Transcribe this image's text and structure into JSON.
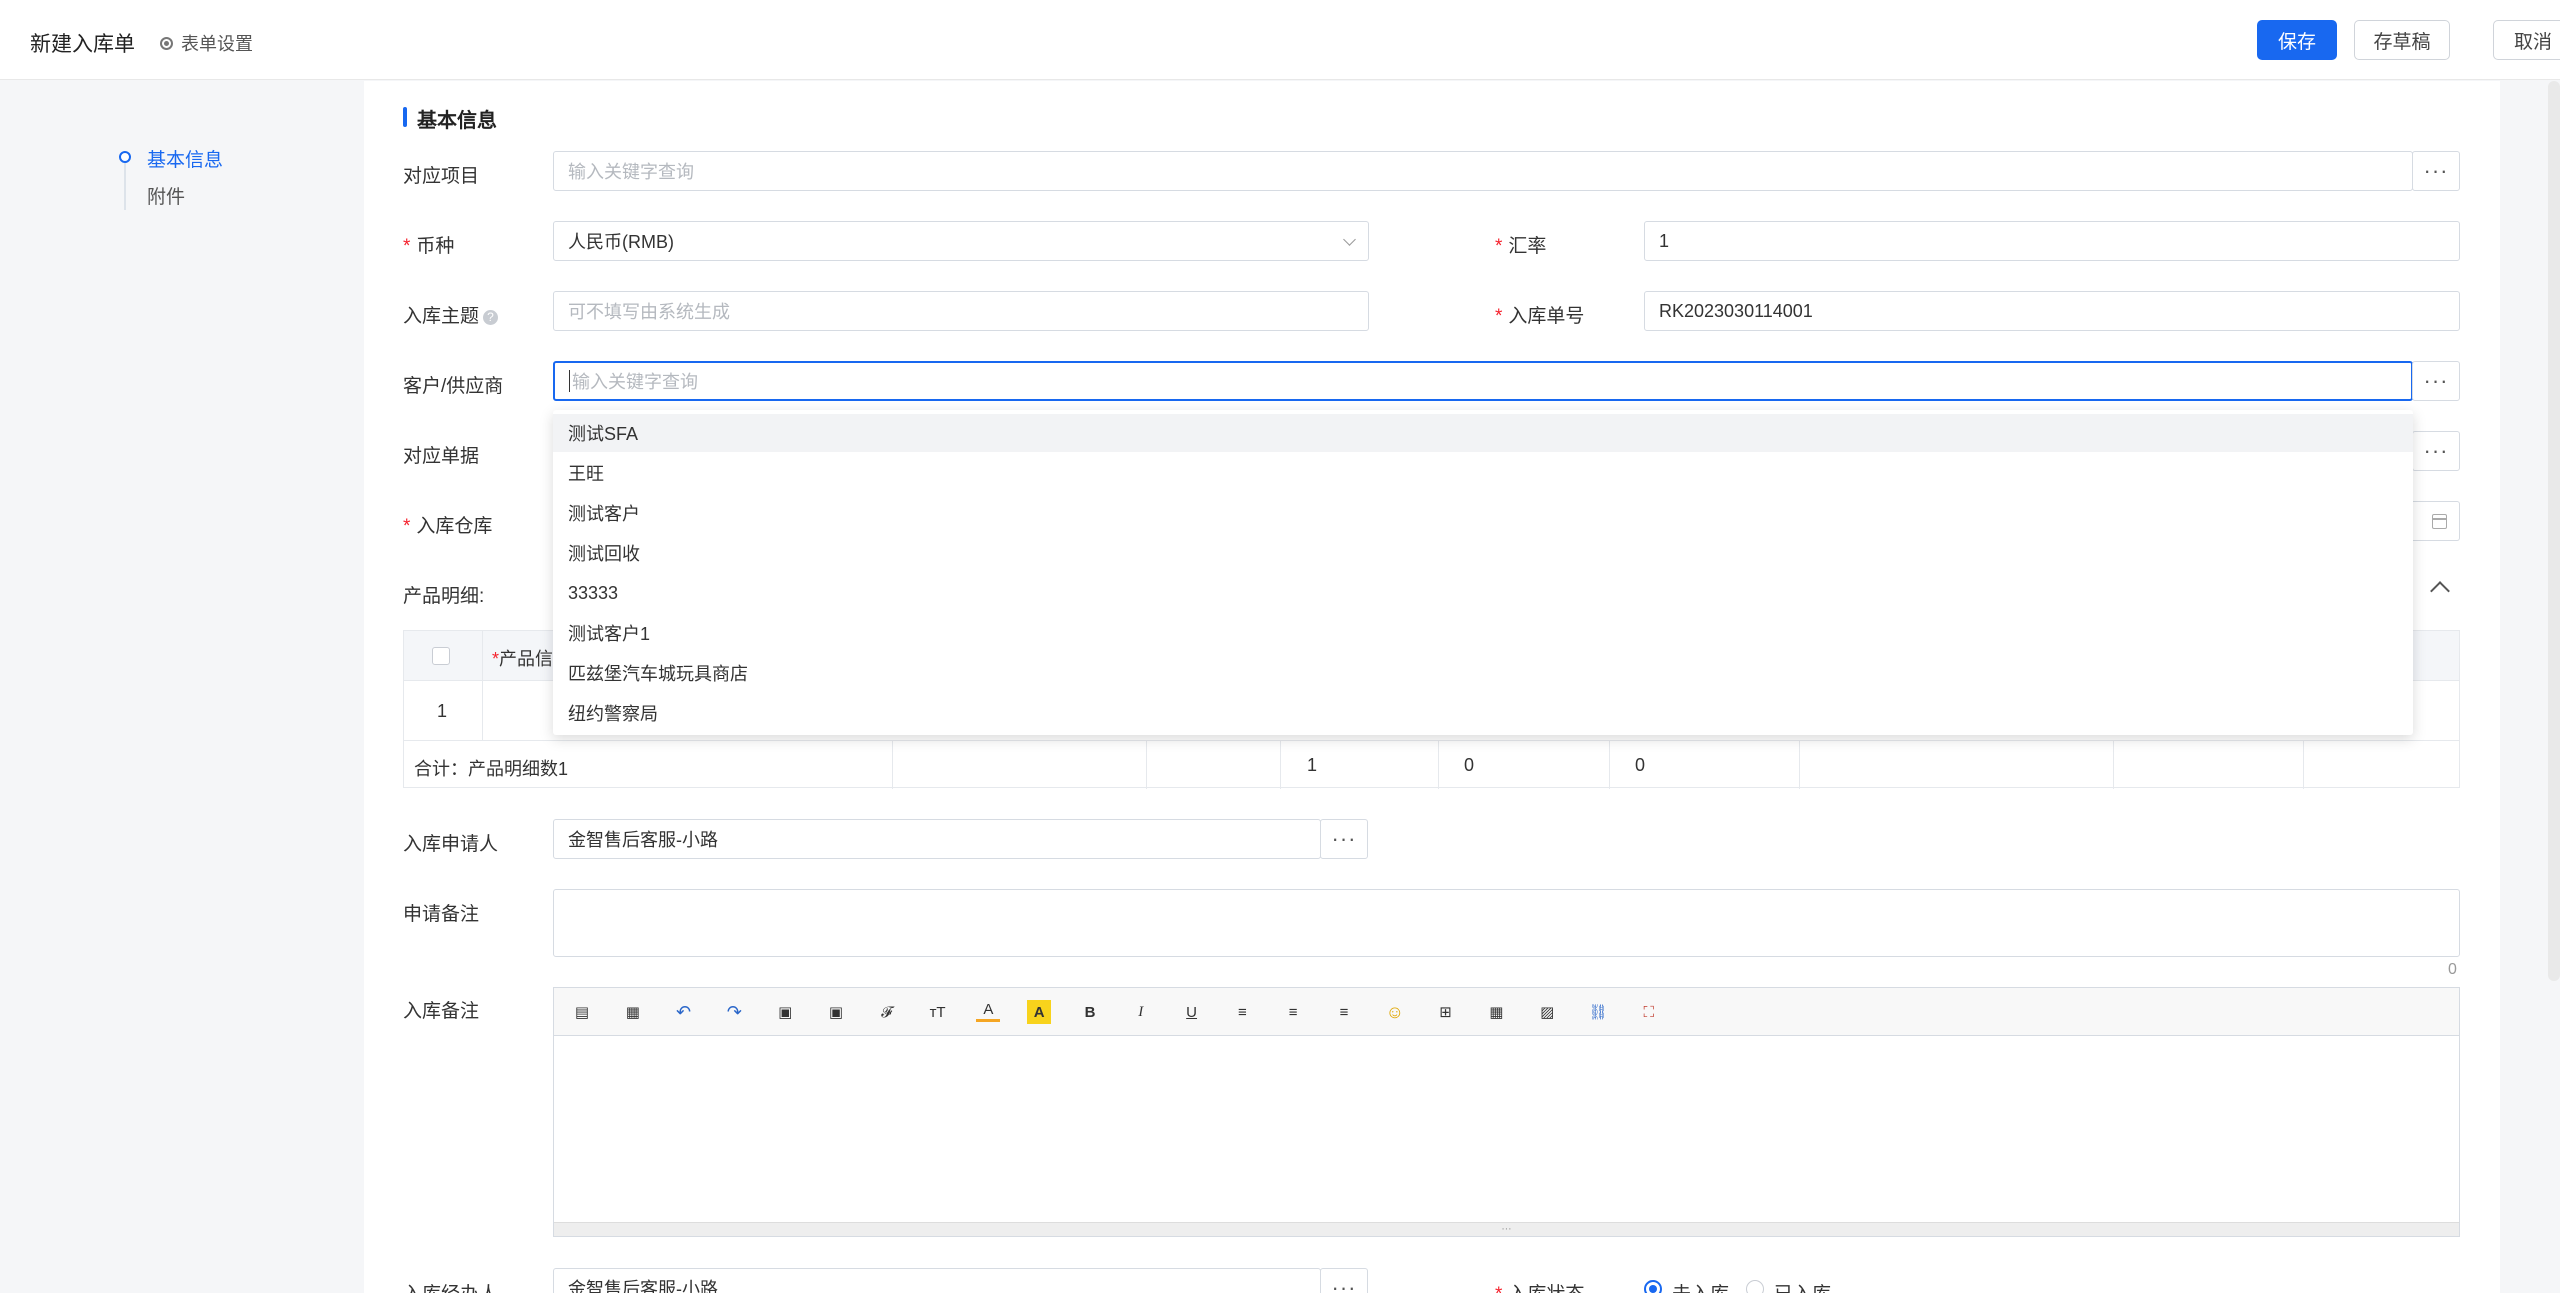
{
  "header": {
    "title": "新建入库单",
    "form_settings": "表单设置",
    "save": "保存",
    "draft": "存草稿",
    "cancel": "取消"
  },
  "nav": {
    "items": [
      {
        "label": "基本信息",
        "active": true
      },
      {
        "label": "附件",
        "active": false
      }
    ]
  },
  "section": {
    "title": "基本信息"
  },
  "fields": {
    "project": {
      "label": "对应项目",
      "placeholder": "输入关键字查询"
    },
    "currency": {
      "label": "币种",
      "value": "人民币(RMB)"
    },
    "rate": {
      "label": "汇率",
      "value": "1"
    },
    "subject": {
      "label": "入库主题",
      "placeholder": "可不填写由系统生成"
    },
    "order_no": {
      "label": "入库单号",
      "value": "RK2023030114001"
    },
    "customer": {
      "label": "客户/供应商",
      "placeholder": "输入关键字查询"
    },
    "doc": {
      "label": "对应单据"
    },
    "warehouse": {
      "label": "入库仓库"
    },
    "product": {
      "label": "产品明细:"
    },
    "applicant": {
      "label": "入库申请人",
      "value": "金智售后客服-小路"
    },
    "apply_note": {
      "label": "申请备注",
      "counter": "0"
    },
    "stock_note": {
      "label": "入库备注"
    },
    "operator": {
      "label": "入库经办人",
      "value": "金智售后客服-小路"
    },
    "status": {
      "label": "入库状态",
      "options": [
        "未入库",
        "已入库"
      ],
      "selected": "未入库"
    }
  },
  "product_table": {
    "header_col": "产品信",
    "row_index": "1",
    "sum_label": "合计：产品明细数1",
    "sum_values": [
      "1",
      "0",
      "0"
    ]
  },
  "dropdown": {
    "items": [
      "测试SFA",
      "王旺",
      "测试客户",
      "测试回收",
      "33333",
      "测试客户1",
      "匹兹堡汽车城玩具商店",
      "纽约警察局"
    ]
  },
  "colors": {
    "accent": "#1868f0",
    "required": "#f5222d"
  },
  "icons": {
    "toolbar": [
      "source-icon",
      "new-doc-icon",
      "undo-icon",
      "redo-icon",
      "paste-icon",
      "paste-text-icon",
      "font-family-icon",
      "font-size-icon",
      "font-color-icon",
      "bg-color-icon",
      "bold-icon",
      "italic-icon",
      "underline-icon",
      "align-left-icon",
      "align-center-icon",
      "align-right-icon",
      "emoji-icon",
      "insert-icon",
      "table-icon",
      "image-icon",
      "link-icon",
      "fullscreen-icon"
    ],
    "toolbar_glyphs": [
      "▤",
      "▦",
      "↶",
      "↷",
      "▣",
      "▣",
      "𝓕",
      "ᴛT",
      "A",
      "A",
      "B",
      "I",
      "U",
      "≡",
      "≡",
      "≡",
      "☺",
      "⊞",
      "▦",
      "▨",
      "⛓",
      "⛶"
    ]
  }
}
